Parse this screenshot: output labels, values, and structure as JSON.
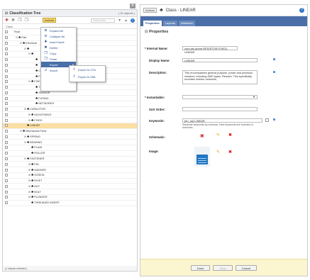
{
  "left": {
    "title": "Classification Tree",
    "count": "( 32 objects )",
    "actions_label": "Actions",
    "find_placeholder": "Find in tree",
    "column": "Class",
    "status": "(1 objects selected )"
  },
  "tree": [
    {
      "d": 0,
      "t": "Root"
    },
    {
      "d": 1,
      "t": "Part",
      "exp": "⊟"
    },
    {
      "d": 2,
      "t": "Electrical",
      "exp": "⊟"
    },
    {
      "d": 3,
      "t": "",
      "exp": "⊟"
    },
    {
      "d": 4,
      "t": "",
      "exp": "⊟"
    },
    {
      "d": 5,
      "t": ""
    },
    {
      "d": 5,
      "t": ""
    },
    {
      "d": 5,
      "t": "CONTROLS"
    },
    {
      "d": 5,
      "t": "PRECISION"
    },
    {
      "d": 4,
      "t": "FIXED",
      "exp": "⊟"
    },
    {
      "d": 5,
      "t": "THERMOSTAT"
    },
    {
      "d": 5,
      "t": "SENSOR"
    },
    {
      "d": 5,
      "t": "FUSING"
    },
    {
      "d": 5,
      "t": "NETWORKS"
    },
    {
      "d": 3,
      "t": "CAPACITOR",
      "exp": "⊞"
    },
    {
      "d": 4,
      "t": "ADJUSTABLE",
      "exp": "⊞"
    },
    {
      "d": 4,
      "t": "FIXED",
      "exp": "⊞"
    },
    {
      "d": 3,
      "t": "LINEAR",
      "sel": true
    },
    {
      "d": 2,
      "t": "Mechanical Parts",
      "exp": "⊟"
    },
    {
      "d": 3,
      "t": "SPRING",
      "exp": "⊞"
    },
    {
      "d": 3,
      "t": "BEARING",
      "exp": "⊟"
    },
    {
      "d": 4,
      "t": "PLAIN"
    },
    {
      "d": 4,
      "t": "ROLLER"
    },
    {
      "d": 3,
      "t": "FASTENER",
      "exp": "⊟"
    },
    {
      "d": 4,
      "t": "PIN",
      "exp": "⊞"
    },
    {
      "d": 4,
      "t": "WASHER",
      "exp": "⊞"
    },
    {
      "d": 4,
      "t": "SCREW",
      "exp": "⊞"
    },
    {
      "d": 4,
      "t": "RIVET",
      "exp": "⊞"
    },
    {
      "d": 4,
      "t": "NUT",
      "exp": "⊞"
    },
    {
      "d": 4,
      "t": "BOLT",
      "exp": "⊞"
    },
    {
      "d": 4,
      "t": "PLUNGER",
      "exp": "⊞"
    },
    {
      "d": 4,
      "t": "THREADED INSERT"
    }
  ],
  "menu": [
    {
      "icon": "⊕",
      "label": "Expand All"
    },
    {
      "icon": "⊖",
      "label": "Collapse All"
    },
    {
      "icon": "✚",
      "label": "Insert Node"
    },
    {
      "icon": "✖",
      "label": "Delete"
    },
    {
      "icon": "❐",
      "label": "Copy"
    },
    {
      "icon": "❐",
      "label": "Paste"
    },
    {
      "icon": "",
      "label": "Export",
      "hl": true,
      "arrow": "▸"
    },
    {
      "icon": "↲",
      "label": "Import"
    }
  ],
  "submenu": [
    {
      "label": "Export to CSV"
    },
    {
      "label": "Export to XML"
    }
  ],
  "right": {
    "actions_label": "Actions",
    "class_label": "Class - LINEAR",
    "tabs": [
      "Properties",
      "Layouts",
      "Attributes"
    ],
    "section": "Properties",
    "internal_name_label": "* Internal Name:",
    "internal_name": "com.ptc.pbom.RESISTOR-FIXED-LINEAR",
    "display_name_label": "Display Name:",
    "display_name": "LINEAR",
    "description_label": "Description:",
    "description": "This encompasses general purpose, power and precision resistors, including SMD types. Remark: This specifically excludes resistor networks,",
    "instantiable_label": "* Instantiable:",
    "instantiable": "",
    "sort_order_label": "Sort Order:",
    "sort_order": "",
    "keywords_label": "Keywords:",
    "keywords": "[en_us] LINEAR",
    "keywords_hint": "Separate keywords by commas. New keywords are included in searches.",
    "schematic_label": "Schematic:",
    "image_label": "Image:",
    "done": "Done",
    "save": "Save",
    "cancel": "Cancel"
  }
}
